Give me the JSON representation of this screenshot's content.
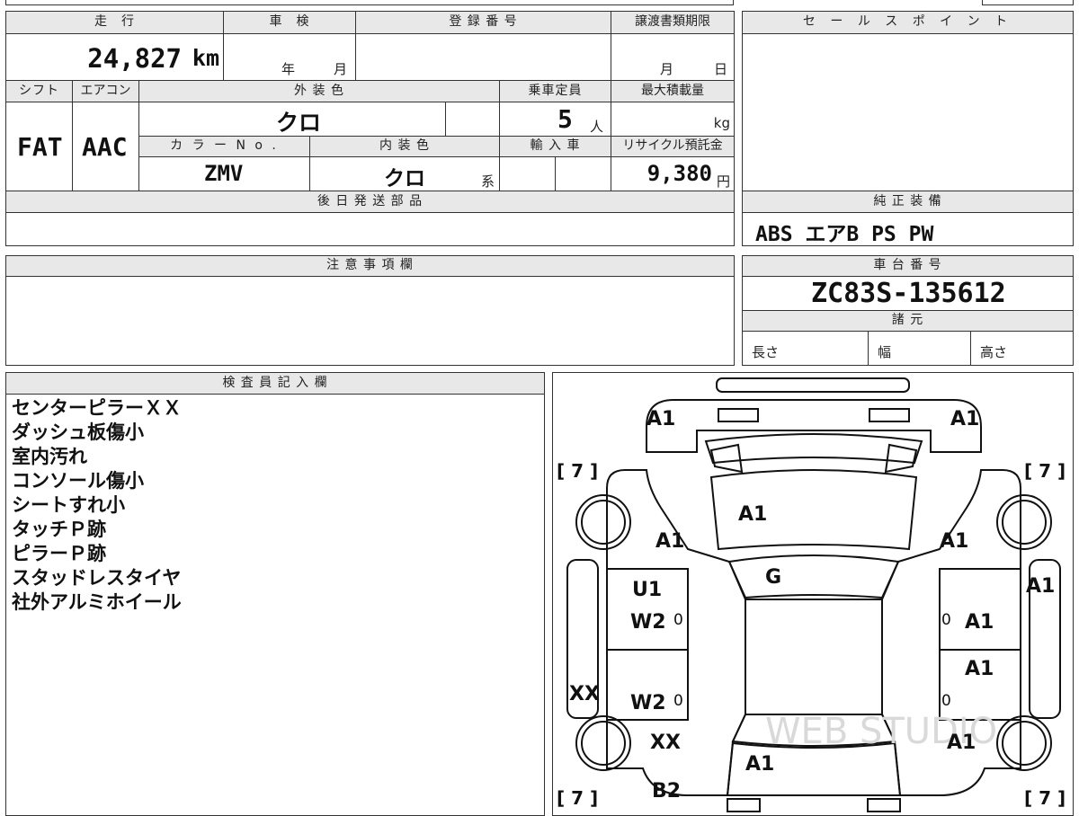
{
  "header": {
    "mileage_label": "走　行",
    "inspection_label": "車　検",
    "registration_label": "登 録 番 号",
    "transfer_deadline_label": "譲渡書類期限",
    "sales_point_label": "セ ー ル ス ポ イ ン ト"
  },
  "vehicle": {
    "mileage_value": "24,827",
    "mileage_unit": "km",
    "inspection_year_unit": "年",
    "inspection_month_unit": "月",
    "transfer_month_unit": "月",
    "transfer_day_unit": "日",
    "shift_label": "シフト",
    "aircon_label": "エアコン",
    "exterior_color_label": "外 装 色",
    "capacity_label": "乗車定員",
    "max_load_label": "最大積載量",
    "shift_value": "FAT",
    "aircon_value": "AAC",
    "exterior_color_value": "クロ",
    "capacity_value": "5",
    "capacity_unit": "人",
    "max_load_unit": "kg",
    "color_no_label": "カ ラ ー N o .",
    "interior_color_label": "内 装 色",
    "import_label": "輸 入 車",
    "recycle_label": "リサイクル預託金",
    "color_no_value": "ZMV",
    "interior_color_value": "クロ",
    "interior_color_suffix": "系",
    "recycle_value": "9,380",
    "recycle_unit": "円",
    "later_parts_label": "後 日 発 送 部 品"
  },
  "equipment": {
    "label": "純 正 装 備",
    "value": "ABS エアB PS PW"
  },
  "notes": {
    "label": "注 意 事 項 欄"
  },
  "chassis": {
    "label": "車 台 番 号",
    "value": "ZC83S-135612",
    "specs_label": "諸 元",
    "length_label": "長さ",
    "width_label": "幅",
    "height_label": "高さ"
  },
  "inspector": {
    "label": "検 査 員 記 入 欄",
    "lines": [
      "センターピラーＸＸ",
      "ダッシュ板傷小",
      "室内汚れ",
      "コンソール傷小",
      "シートすれ小",
      "タッチＰ跡",
      "ピラーＰ跡",
      "スタッドレスタイヤ",
      "社外アルミホイール"
    ]
  },
  "diagram": {
    "tire_tl": "[ 7 ]",
    "tire_tr": "[ 7 ]",
    "tire_bl": "[ 7 ]",
    "tire_br": "[ 7 ]",
    "front_left": "A1",
    "front_right": "A1",
    "hood": "A1",
    "fender_left": "A1",
    "fender_right": "A1",
    "windshield": "G",
    "front_door_left_1": "U1",
    "front_door_left_2": "W2",
    "front_door_left_0": "0",
    "front_door_right_0": "0",
    "front_door_right": "A1",
    "right_pillar": "A1",
    "rear_door_right": "A1",
    "rear_door_right_0": "0",
    "left_side": "XX",
    "rear_door_left": "W2",
    "rear_door_left_0": "0",
    "rear_left": "XX",
    "rear_right": "A1",
    "tailgate": "A1",
    "rear_bumper": "B2",
    "watermark": "WEB STUDIO"
  }
}
